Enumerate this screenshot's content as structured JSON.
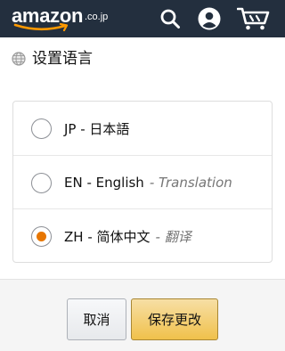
{
  "header": {
    "logo_text": "amazon",
    "logo_suffix": ".co.jp",
    "icons": [
      "search-icon",
      "account-icon",
      "cart-icon"
    ],
    "background_color": "#232f3e"
  },
  "section": {
    "icon": "globe-icon",
    "title": "设置语言"
  },
  "languages": [
    {
      "code_label": "JP - 日本語",
      "sub_label": "",
      "selected": false
    },
    {
      "code_label": "EN - English",
      "sub_label": "- Translation",
      "selected": false
    },
    {
      "code_label": "ZH - 简体中文",
      "sub_label": "- 翻译",
      "selected": true
    }
  ],
  "buttons": {
    "cancel_label": "取消",
    "save_label": "保存更改"
  },
  "colors": {
    "radio_selected": "#e77600",
    "primary_button": "#f0c14b"
  }
}
